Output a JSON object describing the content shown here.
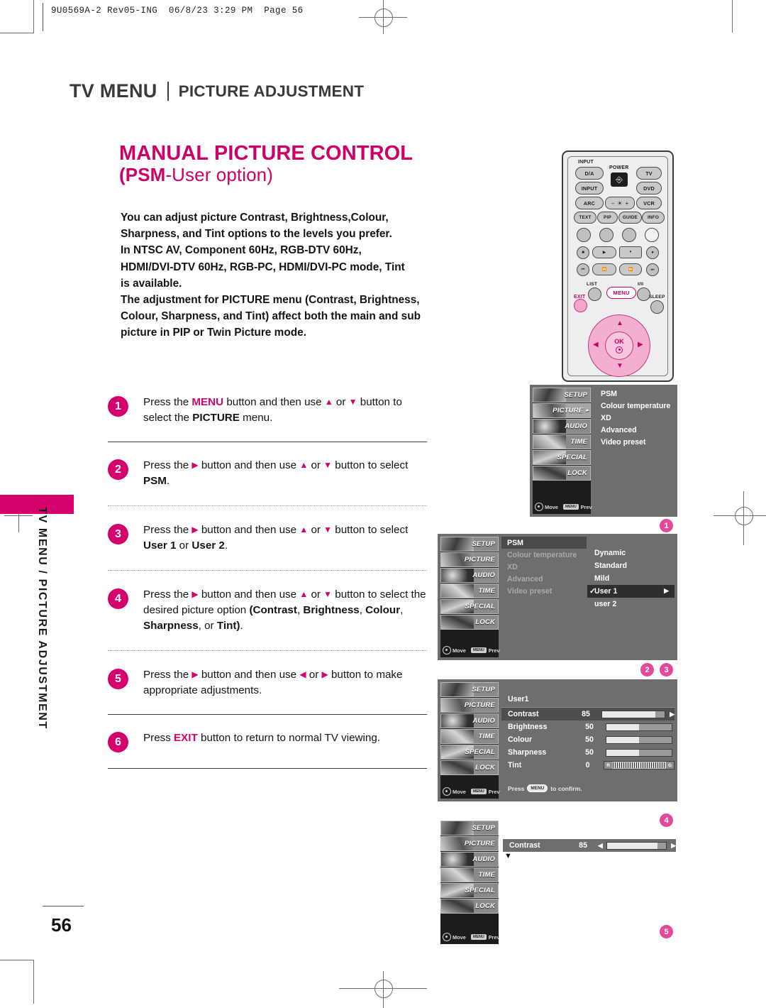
{
  "print_slug": "9U0569A-2 Rev05-ING  06/8/23 3:29 PM  Page 56",
  "page_number": "56",
  "header": {
    "section": "TV MENU",
    "subsection": "PICTURE ADJUSTMENT"
  },
  "title": {
    "line1": "MANUAL PICTURE CONTROL",
    "line2_a": "(PSM",
    "line2_b": "-User option)"
  },
  "side_tab": "TV MENU / PICTURE ADJUSTMENT",
  "intro": [
    "You can adjust picture Contrast, Brightness,Colour,",
    "Sharpness, and Tint options to the levels you prefer.",
    "In NTSC AV, Component 60Hz, RGB-DTV 60Hz,",
    "HDMI/DVI-DTV 60Hz, RGB-PC, HDMI/DVI-PC mode, Tint",
    "is available.",
    "The adjustment for PICTURE menu (Contrast, Brightness,",
    "Colour, Sharpness, and Tint) affect both the main and sub",
    "picture in PIP or Twin Picture mode."
  ],
  "steps": [
    {
      "num": "1",
      "segments": [
        {
          "t": "Press the ",
          "s": "n"
        },
        {
          "t": "MENU",
          "s": "m"
        },
        {
          "t": " button and then use ",
          "s": "n"
        },
        {
          "t": "▲",
          "s": "a"
        },
        {
          "t": " or ",
          "s": "n"
        },
        {
          "t": "▼",
          "s": "a"
        },
        {
          "t": " button ",
          "s": "n"
        },
        {
          "t": "to select the ",
          "s": "n"
        },
        {
          "t": "PICTURE",
          "s": "b"
        },
        {
          "t": " menu.",
          "s": "n"
        }
      ]
    },
    {
      "num": "2",
      "segments": [
        {
          "t": "Press the ",
          "s": "n"
        },
        {
          "t": "▶",
          "s": "a"
        },
        {
          "t": " button and then use ",
          "s": "n"
        },
        {
          "t": "▲",
          "s": "a"
        },
        {
          "t": " or ",
          "s": "n"
        },
        {
          "t": "▼",
          "s": "a"
        },
        {
          "t": " button to ",
          "s": "n"
        },
        {
          "t": "select ",
          "s": "n"
        },
        {
          "t": "PSM",
          "s": "b"
        },
        {
          "t": ".",
          "s": "n"
        }
      ]
    },
    {
      "num": "3",
      "segments": [
        {
          "t": "Press the ",
          "s": "n"
        },
        {
          "t": "▶",
          "s": "a"
        },
        {
          "t": " button and then use ",
          "s": "n"
        },
        {
          "t": "▲",
          "s": "a"
        },
        {
          "t": " or ",
          "s": "n"
        },
        {
          "t": "▼",
          "s": "a"
        },
        {
          "t": " button to ",
          "s": "n"
        },
        {
          "t": "select ",
          "s": "n"
        },
        {
          "t": "User 1",
          "s": "b"
        },
        {
          "t": " or ",
          "s": "n"
        },
        {
          "t": "User 2",
          "s": "b"
        },
        {
          "t": ".",
          "s": "n"
        }
      ]
    },
    {
      "num": "4",
      "segments": [
        {
          "t": "Press the ",
          "s": "n"
        },
        {
          "t": "▶",
          "s": "a"
        },
        {
          "t": " button and then use ",
          "s": "n"
        },
        {
          "t": "▲",
          "s": "a"
        },
        {
          "t": " or ",
          "s": "n"
        },
        {
          "t": "▼",
          "s": "a"
        },
        {
          "t": " button to ",
          "s": "n"
        },
        {
          "t": "select the desired picture option ",
          "s": "n"
        },
        {
          "t": "(Contrast",
          "s": "b"
        },
        {
          "t": ", ",
          "s": "n"
        },
        {
          "t": "Brightness",
          "s": "b"
        },
        {
          "t": ", ",
          "s": "n"
        },
        {
          "t": "Colour",
          "s": "b"
        },
        {
          "t": ", ",
          "s": "n"
        },
        {
          "t": "Sharpness",
          "s": "b"
        },
        {
          "t": ", or ",
          "s": "n"
        },
        {
          "t": "Tint)",
          "s": "b"
        },
        {
          "t": ".",
          "s": "n"
        }
      ]
    },
    {
      "num": "5",
      "segments": [
        {
          "t": "Press the ",
          "s": "n"
        },
        {
          "t": "▶",
          "s": "a"
        },
        {
          "t": " button and then use ",
          "s": "n"
        },
        {
          "t": "◀",
          "s": "a"
        },
        {
          "t": " or ",
          "s": "n"
        },
        {
          "t": "▶",
          "s": "a"
        },
        {
          "t": " button to ",
          "s": "n"
        },
        {
          "t": "make appropriate adjustments.",
          "s": "n"
        }
      ]
    },
    {
      "num": "6",
      "segments": [
        {
          "t": "Press ",
          "s": "n"
        },
        {
          "t": "EXIT",
          "s": "m"
        },
        {
          "t": " button to return to normal TV viewing.",
          "s": "n"
        }
      ]
    }
  ],
  "remote": {
    "input_label": "INPUT",
    "power_label": "POWER",
    "buttons_row1": [
      "D/A",
      "TV"
    ],
    "buttons_row2": [
      "INPUT",
      "DVD"
    ],
    "buttons_row3": [
      "ARC",
      "VCR"
    ],
    "brightness_minus": "–",
    "brightness_plus": "+",
    "buttons_row4": [
      "TEXT",
      "PIP",
      "GUIDE",
      "INFO"
    ],
    "transport": [
      "■",
      "▶",
      "❚❚",
      "●"
    ],
    "skip": [
      "⏮",
      "◀◀",
      "▶▶",
      "⏭"
    ],
    "list_label": "LIST",
    "menu_label": "MENU",
    "iii_label": "I/II",
    "exit_label": "EXIT",
    "sleep_label": "SLEEP",
    "ok_label": "OK",
    "arrows": {
      "up": "▲",
      "down": "▼",
      "left": "◀",
      "right": "▶"
    }
  },
  "osd": {
    "rail": [
      "SETUP",
      "PICTURE",
      "AUDIO",
      "TIME",
      "SPECIAL",
      "LOCK"
    ],
    "rail_selected_1": "PICTURE",
    "foot_move": "Move",
    "foot_menu": "MENU",
    "foot_prev": "Prev",
    "picture_menu": [
      "PSM",
      "Colour temperature",
      "XD",
      "Advanced",
      "Video preset"
    ],
    "psm_options": [
      "Dynamic",
      "Standard",
      "Mild",
      "User 1",
      "user 2"
    ],
    "psm_selected": "User 1",
    "check_mark": "✓",
    "arrow_right": "▶",
    "arrow_left": "◀",
    "arrow_down": "▼",
    "user_header": "User1",
    "sliders": [
      {
        "name": "Contrast",
        "value": "85",
        "pct": 85
      },
      {
        "name": "Brightness",
        "value": "50",
        "pct": 50
      },
      {
        "name": "Colour",
        "value": "50",
        "pct": 50
      },
      {
        "name": "Sharpness",
        "value": "50",
        "pct": 50
      }
    ],
    "tint": {
      "name": "Tint",
      "value": "0",
      "left_cap": "R",
      "right_cap": "G"
    },
    "confirm_pre": "Press",
    "confirm_btn": "MENU",
    "confirm_post": "to confirm.",
    "contrast_row": {
      "name": "Contrast",
      "value": "85",
      "pct": 85
    },
    "badges": [
      "1",
      "2",
      "3",
      "4",
      "5"
    ]
  },
  "colors": {
    "magenta": "#D4006E",
    "title_magenta": "#CC0066",
    "badge_pink": "#E2499B"
  }
}
